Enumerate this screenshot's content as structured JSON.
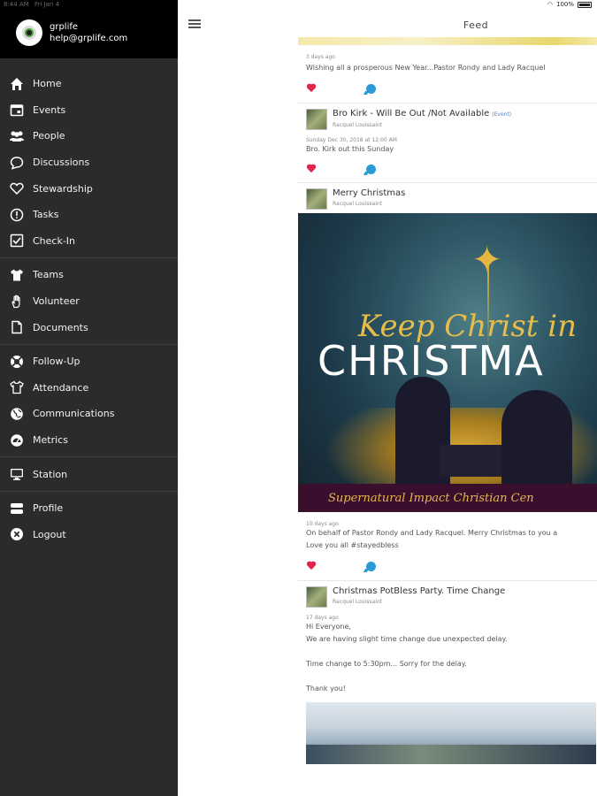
{
  "status_bar": {
    "time": "8:44 AM",
    "date": "Fri Jan 4",
    "battery": "100%"
  },
  "sidebar": {
    "account": {
      "name": "grplife",
      "email": "help@grplife.com"
    },
    "groups": [
      [
        {
          "label": "Home",
          "icon": "home-icon"
        },
        {
          "label": "Events",
          "icon": "calendar-icon"
        },
        {
          "label": "People",
          "icon": "people-icon"
        },
        {
          "label": "Discussions",
          "icon": "chat-icon"
        },
        {
          "label": "Stewardship",
          "icon": "heart-outline-icon"
        },
        {
          "label": "Tasks",
          "icon": "alert-circle-icon"
        },
        {
          "label": "Check-In",
          "icon": "checkbox-icon"
        }
      ],
      [
        {
          "label": "Teams",
          "icon": "shirt-icon"
        },
        {
          "label": "Volunteer",
          "icon": "hand-icon"
        },
        {
          "label": "Documents",
          "icon": "document-icon"
        }
      ],
      [
        {
          "label": "Follow-Up",
          "icon": "lifebuoy-icon"
        },
        {
          "label": "Attendance",
          "icon": "shirt-outline-icon"
        },
        {
          "label": "Communications",
          "icon": "globe-icon"
        },
        {
          "label": "Metrics",
          "icon": "gauge-icon"
        }
      ],
      [
        {
          "label": "Station",
          "icon": "monitor-icon"
        }
      ],
      [
        {
          "label": "Profile",
          "icon": "server-icon"
        },
        {
          "label": "Logout",
          "icon": "close-circle-icon"
        }
      ]
    ]
  },
  "appbar": {
    "title": "Feed"
  },
  "feed": {
    "posts": [
      {
        "meta": "3 days ago",
        "body": "Wishing all a prosperous New Year...Pastor Rondy and Lady Racquel"
      },
      {
        "title": "Bro Kirk - Will Be Out /Not Available",
        "tag": "(Event)",
        "author": "Racquel Louissaint",
        "meta": "Sunday Dec 30, 2018 at 12:00 AM",
        "body": "Bro. Kirk out this Sunday"
      },
      {
        "title": "Merry Christmas",
        "author": "Racquel Louissaint",
        "image": {
          "script_text": "Keep Christ in",
          "caps_text": "CHRISTMA",
          "band_text": "Supernatural Impact Christian Cen"
        },
        "meta": "10 days ago",
        "body_lines": [
          "On behalf of Pastor Rondy and Lady Racquel. Merry Christmas to you a",
          "Love you all #stayedbless"
        ]
      },
      {
        "title": "Christmas PotBless Party. Time Change",
        "author": "Racquel Louissaint",
        "meta": "17 days ago",
        "body_lines": [
          "Hi Everyone,",
          "We are having slight time change due unexpected delay.",
          "",
          "Time change to 5:30pm... Sorry for the delay.",
          "",
          "Thank you!"
        ]
      }
    ]
  }
}
